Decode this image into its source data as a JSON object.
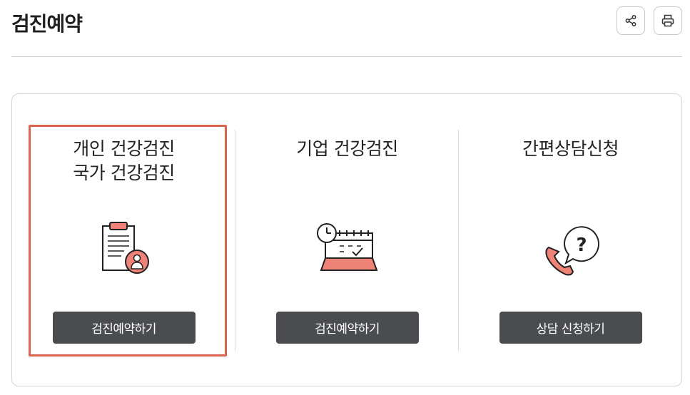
{
  "page": {
    "title": "검진예약"
  },
  "toolbar": {
    "share_icon": "share-icon",
    "print_icon": "printer-icon"
  },
  "cards": [
    {
      "title_line1": "개인 건강검진",
      "title_line2": "국가 건강검진",
      "icon": "clipboard-person-icon",
      "button_label": "검진예약하기",
      "selected": true
    },
    {
      "title_line1": "기업 건강검진",
      "icon": "calendar-clock-icon",
      "button_label": "검진예약하기"
    },
    {
      "title_line1": "간편상담신청",
      "icon": "phone-question-icon",
      "button_label": "상담 신청하기"
    }
  ],
  "colors": {
    "accent": "#d9654f",
    "icon_fill": "#f08377",
    "button_bg": "#4a4c50"
  }
}
